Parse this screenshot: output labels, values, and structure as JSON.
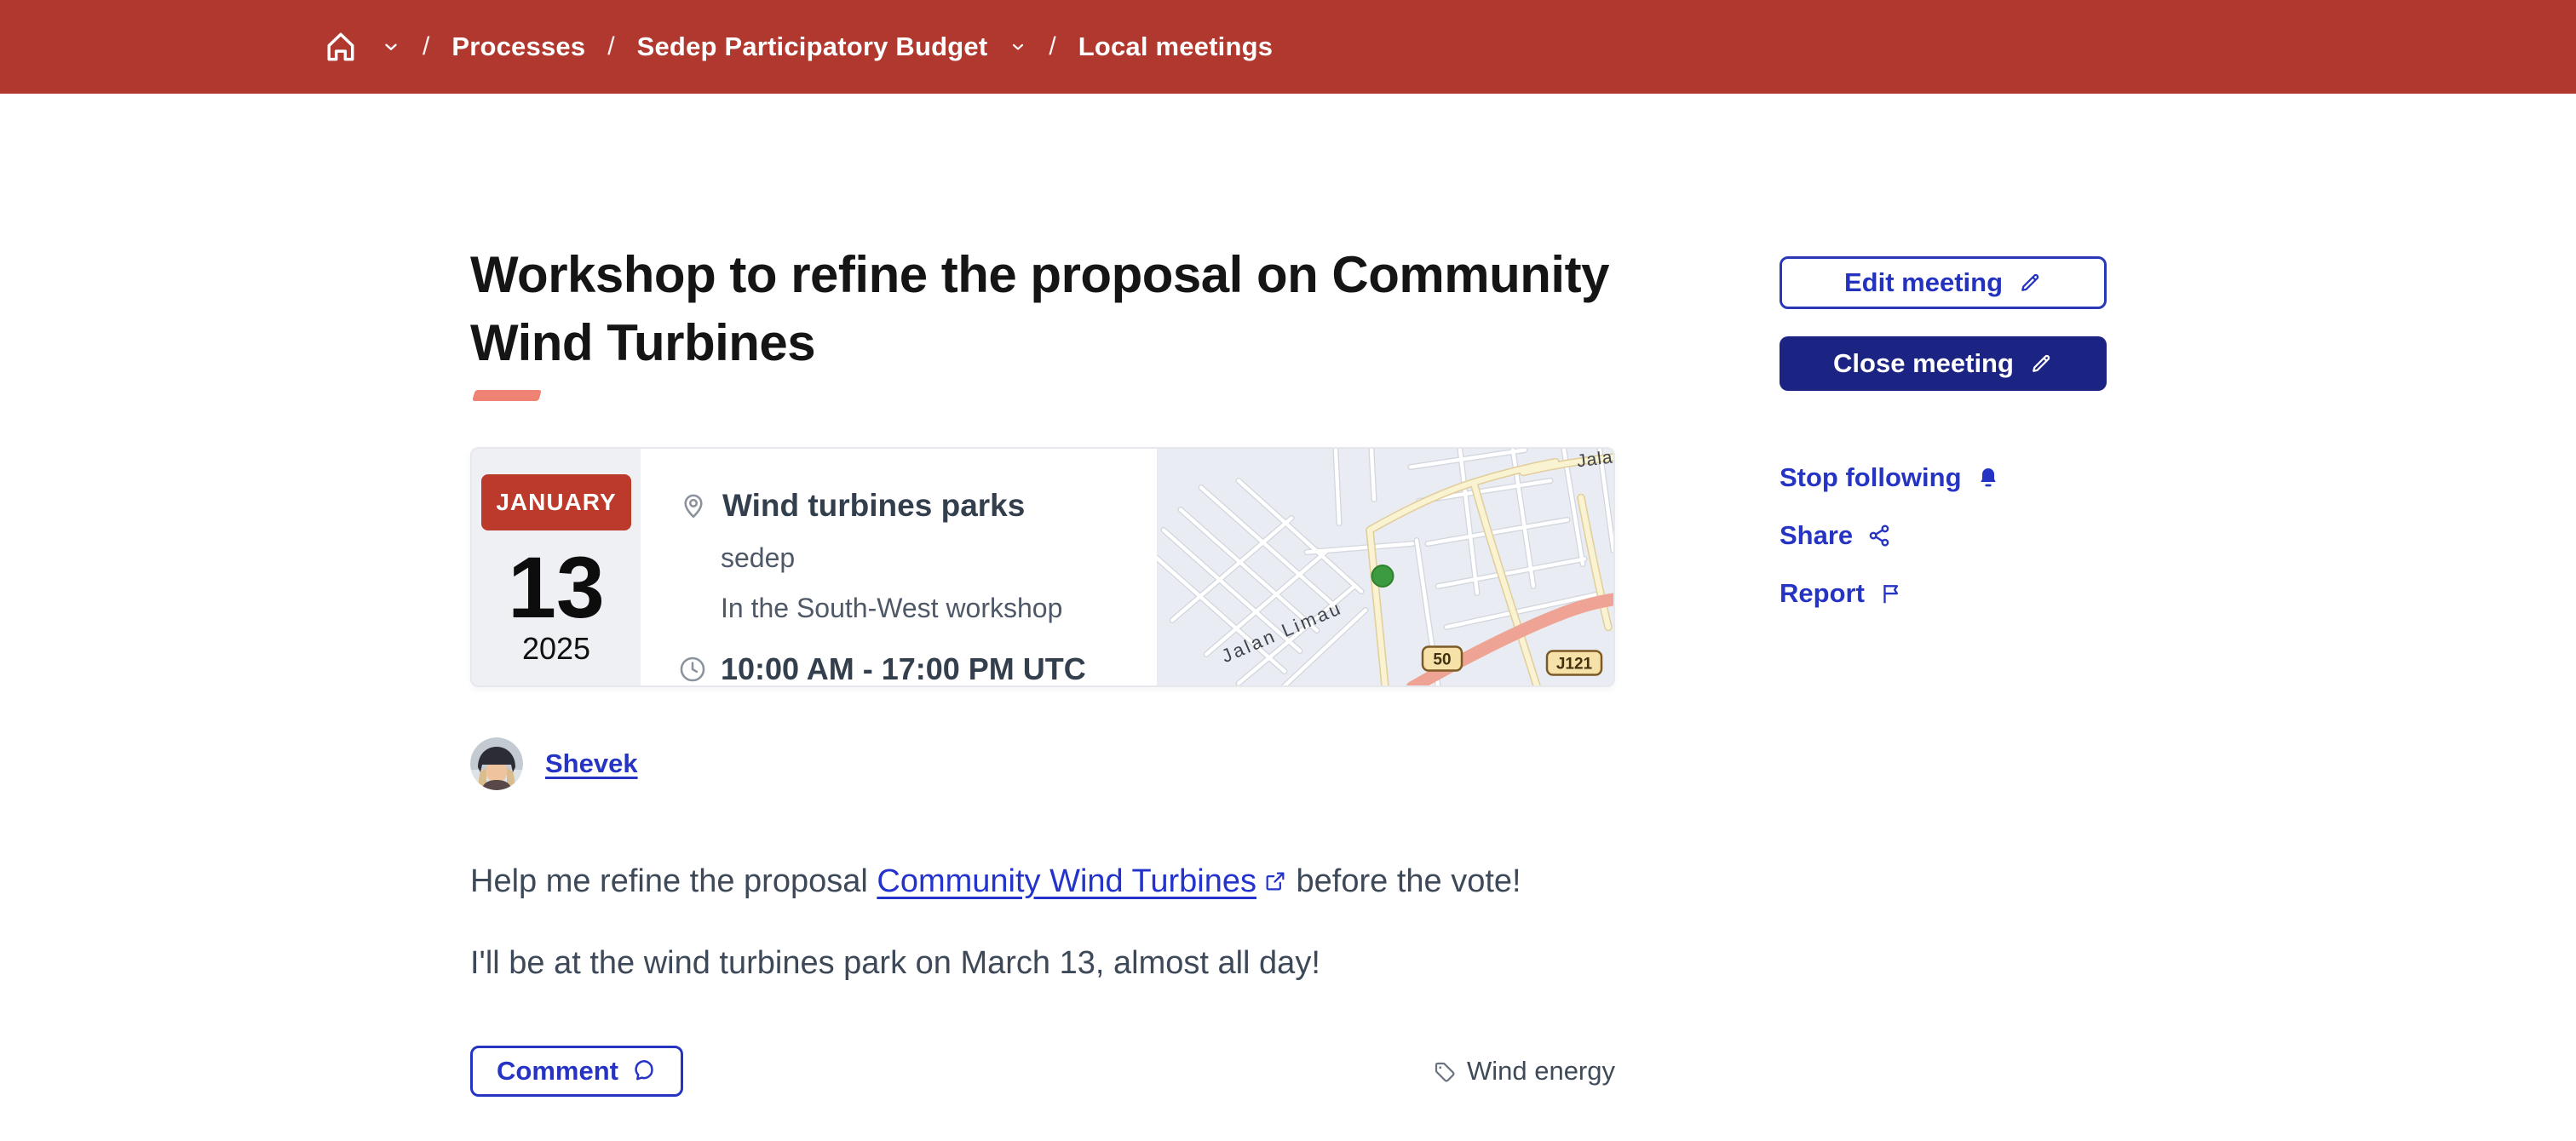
{
  "colors": {
    "header_red": "#b0382e",
    "date_chip_red": "#bb3a2c",
    "primary_blue": "#2634c4",
    "primary_dark_blue": "#1b2383",
    "title_underline": "#ee8273",
    "body_text": "#3d4958",
    "map_marker_green": "#3c9a40"
  },
  "breadcrumb": {
    "separator": "/",
    "items": [
      {
        "label": "Processes"
      },
      {
        "label": "Sedep Participatory Budget"
      },
      {
        "label": "Local meetings"
      }
    ]
  },
  "meeting": {
    "title": "Workshop to refine the proposal on Community Wind Turbines",
    "title_line1": "Workshop to refine the proposal on Community",
    "title_line2": "Wind Turbines",
    "date": {
      "month": "JANUARY",
      "day": "13",
      "year": "2025"
    },
    "location": {
      "name": "Wind turbines parks",
      "organization": "sedep",
      "address": "In the South-West workshop"
    },
    "time": "10:00 AM - 17:00 PM UTC",
    "author": {
      "name": "Shevek"
    },
    "body": {
      "p1_before": "Help me refine the proposal ",
      "p1_link": "Community Wind Turbines",
      "p1_after": " before the vote!",
      "p2": "I'll be at the wind turbines park on March 13, almost all day!"
    },
    "comment_button": "Comment",
    "tag": "Wind energy"
  },
  "actions": {
    "edit": "Edit meeting",
    "close": "Close meeting",
    "stop_following": "Stop following",
    "share": "Share",
    "report": "Report"
  },
  "map": {
    "street_label": "Jalan Limau",
    "street_label_partial": "Jala",
    "route_badge_primary": "50",
    "route_badge_secondary": "J121"
  },
  "icons": [
    "home-icon",
    "chevron-down-icon",
    "map-pin-icon",
    "clock-icon",
    "external-link-icon",
    "comment-icon",
    "tag-icon",
    "pencil-icon",
    "bell-icon",
    "share-icon",
    "flag-icon"
  ]
}
